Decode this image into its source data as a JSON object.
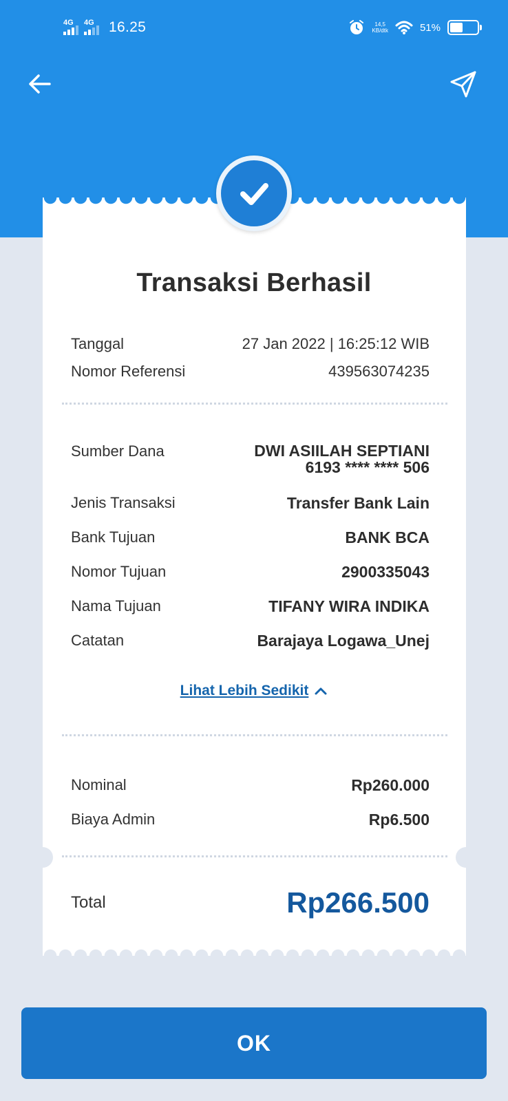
{
  "status_bar": {
    "signal1_label": "4G",
    "signal2_label": "4G",
    "time": "16.25",
    "speed_value": "14,5",
    "speed_unit": "KB/dtk",
    "battery_pct": "51%",
    "icons": [
      "alarm-icon",
      "wifi-icon",
      "battery-icon"
    ]
  },
  "header": {
    "back_icon": "arrow-left-icon",
    "share_icon": "send-icon"
  },
  "receipt": {
    "title": "Transaksi Berhasil",
    "date_label": "Tanggal",
    "date_value": "27 Jan 2022 | 16:25:12 WIB",
    "ref_label": "Nomor Referensi",
    "ref_value": "439563074235",
    "details": [
      {
        "label": "Sumber Dana",
        "value": "DWI ASIILAH SEPTIANI",
        "value2": "6193 **** **** 506"
      },
      {
        "label": "Jenis Transaksi",
        "value": "Transfer Bank Lain"
      },
      {
        "label": "Bank Tujuan",
        "value": "BANK BCA"
      },
      {
        "label": "Nomor Tujuan",
        "value": "2900335043"
      },
      {
        "label": "Nama Tujuan",
        "value": "TIFANY WIRA INDIKA"
      },
      {
        "label": "Catatan",
        "value": "Barajaya Logawa_Unej"
      }
    ],
    "toggle_label": "Lihat Lebih Sedikit",
    "nominal_label": "Nominal",
    "nominal_value": "Rp260.000",
    "admin_label": "Biaya Admin",
    "admin_value": "Rp6.500",
    "total_label": "Total",
    "total_value": "Rp266.500"
  },
  "ok_label": "OK",
  "colors": {
    "primary_blue": "#228fe7",
    "button_blue": "#1b76c9",
    "total_blue": "#14589d",
    "background": "#e1e7f0"
  }
}
